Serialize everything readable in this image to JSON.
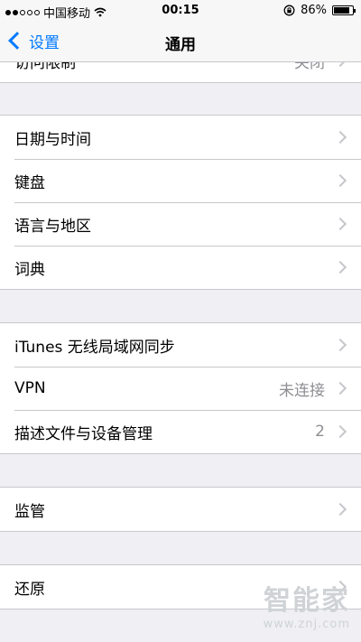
{
  "status_bar": {
    "carrier": "中国移动",
    "time": "00:15",
    "battery_percent": "86%",
    "battery_level": 0.86,
    "signal_dots_filled": 2,
    "signal_dots_total": 5
  },
  "nav": {
    "back_label": "设置",
    "title": "通用"
  },
  "clipped_row": {
    "label": "访问限制",
    "value": "关闭"
  },
  "groups": [
    [
      {
        "label": "日期与时间",
        "value": ""
      },
      {
        "label": "键盘",
        "value": ""
      },
      {
        "label": "语言与地区",
        "value": ""
      },
      {
        "label": "词典",
        "value": ""
      }
    ],
    [
      {
        "label": "iTunes 无线局域网同步",
        "value": ""
      },
      {
        "label": "VPN",
        "value": "未连接"
      },
      {
        "label": "描述文件与设备管理",
        "value": "2"
      }
    ],
    [
      {
        "label": "监管",
        "value": ""
      }
    ],
    [
      {
        "label": "还原",
        "value": ""
      }
    ]
  ],
  "watermark": {
    "main": "智能家",
    "url": "www.znj.com"
  },
  "colors": {
    "accent": "#007aff",
    "background": "#efeff4",
    "separator": "#c8c7cc",
    "secondary_text": "#8e8e93"
  }
}
